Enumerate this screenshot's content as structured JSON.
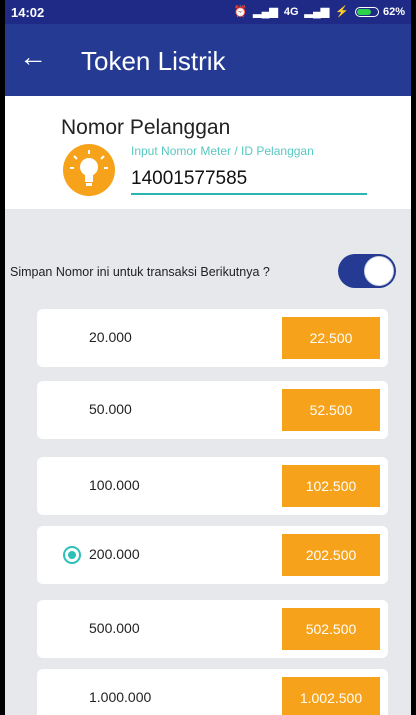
{
  "statusbar": {
    "time": "14:02",
    "network": "4G",
    "battery": "62%",
    "icons": [
      "alarm-icon",
      "signal-icon",
      "signal-icon",
      "charging-icon"
    ]
  },
  "appbar": {
    "back_icon": "←",
    "title": "Token Listrik"
  },
  "customer": {
    "label": "Nomor Pelanggan",
    "hint": "Input Nomor Meter / ID Pelanggan",
    "value": "14001577585"
  },
  "save_option": {
    "text": "Simpan Nomor ini untuk transaksi Berikutnya ?",
    "enabled": true
  },
  "colors": {
    "primary": "#243a93",
    "accent": "#f7a21b",
    "teal": "#27b6b0"
  },
  "options": [
    {
      "amount": "20.000",
      "price": "22.500",
      "selected": false
    },
    {
      "amount": "50.000",
      "price": "52.500",
      "selected": false
    },
    {
      "amount": "100.000",
      "price": "102.500",
      "selected": false
    },
    {
      "amount": "200.000",
      "price": "202.500",
      "selected": true
    },
    {
      "amount": "500.000",
      "price": "502.500",
      "selected": false
    },
    {
      "amount": "1.000.000",
      "price": "1.002.500",
      "selected": false
    }
  ]
}
